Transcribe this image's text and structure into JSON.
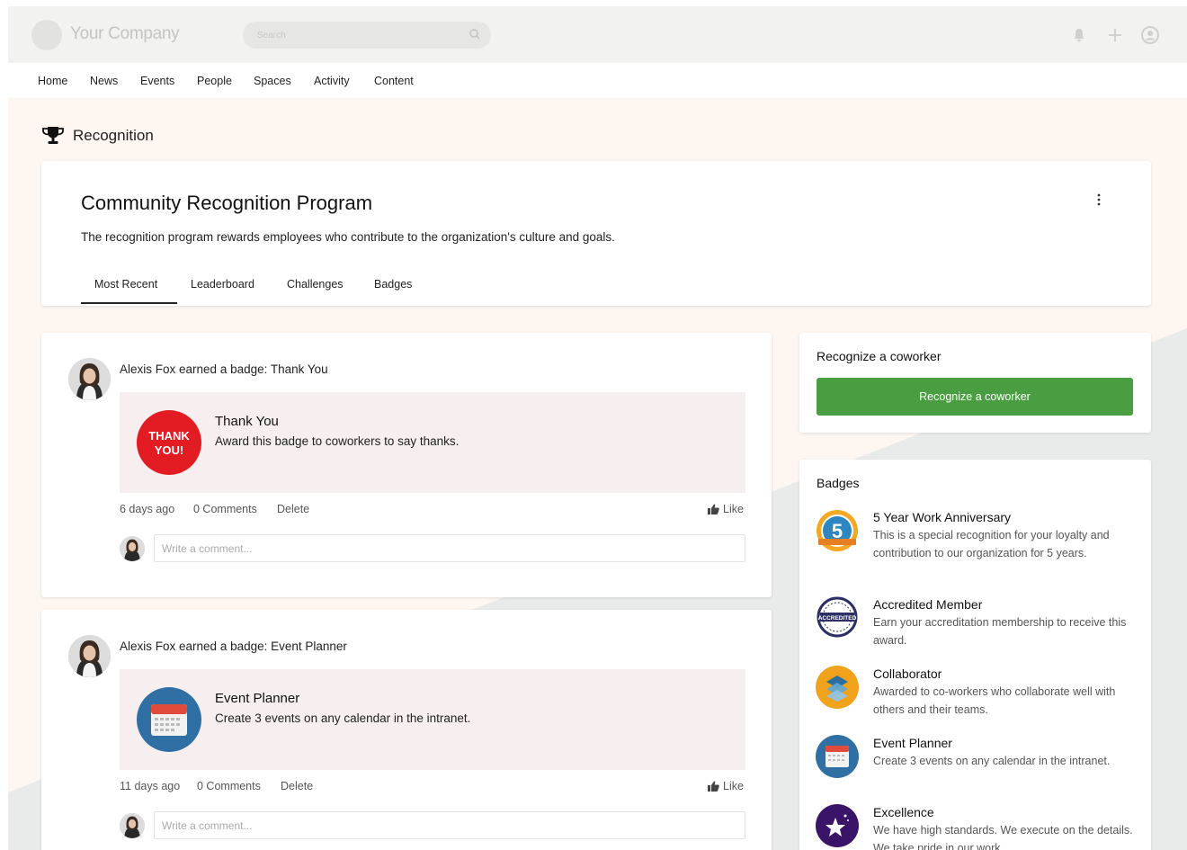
{
  "header": {
    "company": "Your Company",
    "search_placeholder": "Search",
    "icons": [
      "bell-icon",
      "plus-icon",
      "user-icon"
    ]
  },
  "nav": {
    "items": [
      {
        "label": "Home"
      },
      {
        "label": "News"
      },
      {
        "label": "Events"
      },
      {
        "label": "People"
      },
      {
        "label": "Spaces"
      },
      {
        "label": "Activity"
      },
      {
        "label": "Content"
      }
    ]
  },
  "page": {
    "title": "Recognition",
    "icon": "trophy-icon"
  },
  "program": {
    "title": "Community Recognition Program",
    "description": "The recognition program rewards employees who contribute to the organization's culture and goals.",
    "tabs": [
      {
        "label": "Most Recent",
        "active": true
      },
      {
        "label": "Leaderboard",
        "active": false
      },
      {
        "label": "Challenges",
        "active": false
      },
      {
        "label": "Badges",
        "active": false
      }
    ]
  },
  "feed": [
    {
      "author": "Alexis Fox",
      "action": " earned a badge: Thank You",
      "badge_title": "Thank You",
      "badge_desc": "Award this badge to coworkers to say thanks.",
      "badge_icon_text_1": "THANK",
      "badge_icon_text_2": "YOU!",
      "time": "6 days ago",
      "comments": "0 Comments",
      "delete": "Delete",
      "like": "Like",
      "comment_placeholder": "Write a comment..."
    },
    {
      "author": "Alexis Fox",
      "action": " earned a badge: Event Planner",
      "badge_title": "Event Planner",
      "badge_desc": "Create 3 events on any calendar in the intranet.",
      "time": "11 days ago",
      "comments": "0 Comments",
      "delete": "Delete",
      "like": "Like",
      "comment_placeholder": "Write a comment..."
    }
  ],
  "sidebar": {
    "recognize": {
      "title": "Recognize a coworker",
      "button": "Recognize a coworker",
      "button_color": "#4a9e42"
    },
    "badges": {
      "title": "Badges",
      "items": [
        {
          "title": "5 Year Work Anniversary",
          "desc": "This is a special recognition for your loyalty and contribution to our organization for 5 years.",
          "icon": "anniversary-badge-icon",
          "icon_text": "5"
        },
        {
          "title": "Accredited Member",
          "desc": "Earn your accreditation membership to receive this award.",
          "icon": "accredited-badge-icon",
          "icon_text": "ACCREDITED"
        },
        {
          "title": "Collaborator",
          "desc": "Awarded to co-workers who collaborate well with others and their teams.",
          "icon": "collaborator-badge-icon"
        },
        {
          "title": "Event Planner",
          "desc": "Create 3 events on any calendar in the intranet.",
          "icon": "calendar-badge-icon"
        },
        {
          "title": "Excellence",
          "desc": "We have high standards. We execute on the details. We take pride in our work.",
          "icon": "star-badge-icon"
        }
      ]
    }
  }
}
